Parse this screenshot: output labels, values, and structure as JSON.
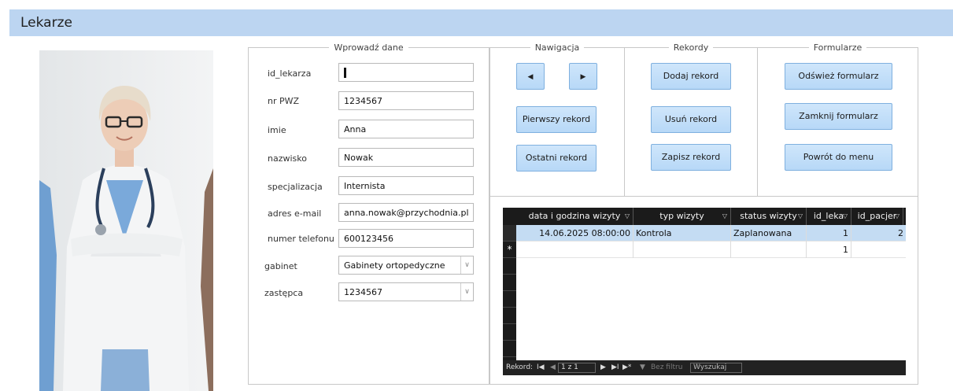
{
  "header": {
    "title": "Lekarze"
  },
  "groups": {
    "input": "Wprowadź dane",
    "navigation": "Nawigacja",
    "records": "Rekordy",
    "forms": "Formularze"
  },
  "fields": [
    {
      "label": "id_lekarza",
      "value": ""
    },
    {
      "label": "nr PWZ",
      "value": "1234567"
    },
    {
      "label": "imie",
      "value": "Anna"
    },
    {
      "label": "nazwisko",
      "value": "Nowak"
    },
    {
      "label": "specjalizacja",
      "value": "Internista"
    },
    {
      "label": "adres e-mail",
      "value": "anna.nowak@przychodnia.pl"
    },
    {
      "label": "numer telefonu",
      "value": "600123456"
    },
    {
      "label": "gabinet",
      "value": "Gabinety ortopedyczne"
    },
    {
      "label": "zastępca",
      "value": "1234567"
    }
  ],
  "id_value": "I",
  "nav": {
    "prev_icon": "◀",
    "next_icon": "▶",
    "first_label": "Pierwszy rekord",
    "last_label": "Ostatni rekord"
  },
  "records": {
    "add_label": "Dodaj rekord",
    "delete_label": "Usuń rekord",
    "save_label": "Zapisz rekord"
  },
  "forms": {
    "refresh_label": "Odśwież formularz",
    "close_label": "Zamknij formularz",
    "menu_label": "Powrót do menu"
  },
  "grid": {
    "columns": [
      "data i godzina wizyty",
      "typ wizyty",
      "status wizyty",
      "id_leka",
      "id_pacjer"
    ],
    "filter_glyph": "▽",
    "rows": [
      [
        "14.06.2025 08:00:00",
        "Kontrola",
        "Zaplanowana",
        "1",
        "2"
      ]
    ],
    "new_row": {
      "marker": "*",
      "id_leka": "1"
    },
    "navigator": {
      "label": "Rekord:",
      "first": "I◀",
      "prev": "◀",
      "position": "1 z 1",
      "next": "▶",
      "last": "▶I",
      "new": "▶*",
      "filter": "Bez filtru",
      "search": "Wyszukaj"
    }
  }
}
